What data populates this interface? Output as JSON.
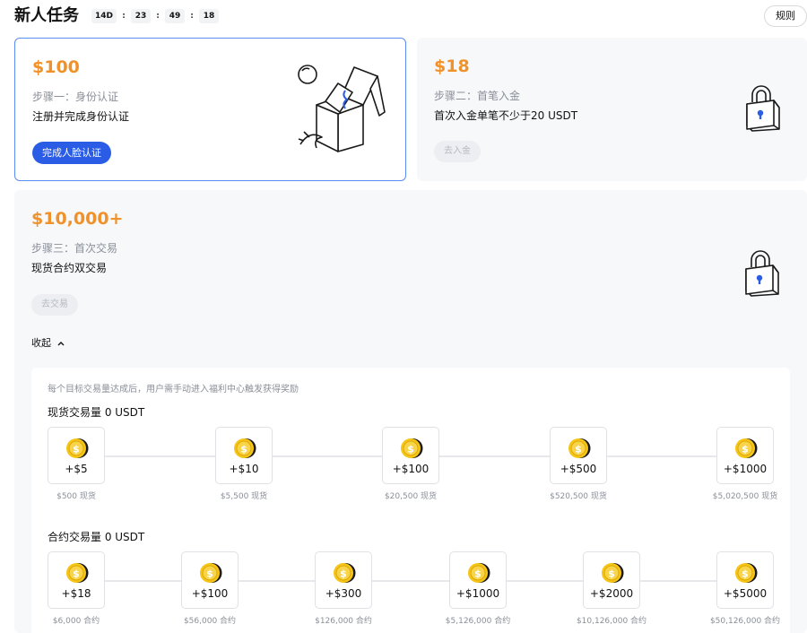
{
  "header": {
    "title": "新人任务",
    "countdown": [
      "14D",
      "23",
      "49",
      "18"
    ],
    "rules_label": "规则"
  },
  "colors": {
    "accent": "#f0922b",
    "primary": "#2a5ce6",
    "active_border": "#5a8df0"
  },
  "tasks": [
    {
      "reward": "$100",
      "step": "步骤一：身份认证",
      "desc": "注册并完成身份认证",
      "button": "完成人脸认证",
      "icon": "gift-box-icon"
    },
    {
      "reward": "$18",
      "step": "步骤二：首笔入金",
      "desc": "首次入金单笔不少于20 USDT",
      "button": "去入金",
      "icon": "padlock-icon"
    },
    {
      "reward": "$10,000+",
      "step": "步骤三：首次交易",
      "desc": "现货合约双交易",
      "button": "去交易",
      "icon": "padlock-icon"
    }
  ],
  "collapse_label": "收起",
  "note": "每个目标交易量达成后，用户需手动进入福利中心触发获得奖励",
  "spot": {
    "title": "现货交易量 0 USDT",
    "milestones": [
      {
        "reward": "+$5",
        "caption": "$500 现货"
      },
      {
        "reward": "+$10",
        "caption": "$5,500 现货"
      },
      {
        "reward": "+$100",
        "caption": "$20,500 现货"
      },
      {
        "reward": "+$500",
        "caption": "$520,500 现货"
      },
      {
        "reward": "+$1000",
        "caption": "$5,020,500 现货"
      }
    ]
  },
  "futures": {
    "title": "合约交易量 0 USDT",
    "milestones": [
      {
        "reward": "+$18",
        "caption": "$6,000 合约"
      },
      {
        "reward": "+$100",
        "caption": "$56,000 合约"
      },
      {
        "reward": "+$300",
        "caption": "$126,000 合约"
      },
      {
        "reward": "+$1000",
        "caption": "$5,126,000 合约"
      },
      {
        "reward": "+$2000",
        "caption": "$10,126,000 合约"
      },
      {
        "reward": "+$5000",
        "caption": "$50,126,000 合约"
      }
    ]
  }
}
